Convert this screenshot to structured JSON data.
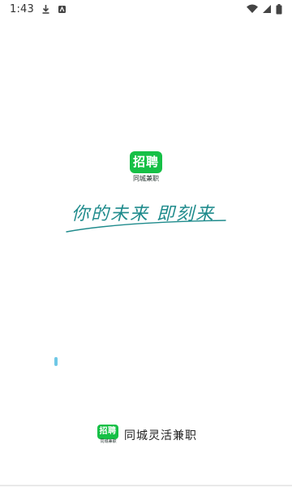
{
  "status_bar": {
    "time": "1:43",
    "icons": [
      "download-icon",
      "sim-icon",
      "wifi-icon",
      "signal-icon",
      "battery-icon"
    ]
  },
  "logo": {
    "badge_text": "招聘",
    "sub_text": "同城兼职",
    "color": "#16c046"
  },
  "slogan": {
    "text": "你的未来 即刻来",
    "color": "#1f8b8c"
  },
  "bottom": {
    "badge_text": "招聘",
    "badge_sub": "同城兼职",
    "title": "同城灵活兼职"
  }
}
